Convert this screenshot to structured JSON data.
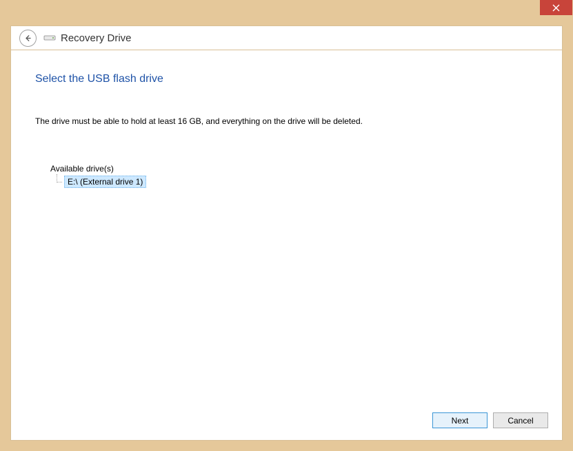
{
  "titlebar": {
    "close_label": "Close"
  },
  "header": {
    "title": "Recovery Drive"
  },
  "content": {
    "heading": "Select the USB flash drive",
    "description": "The drive must be able to hold at least 16 GB, and everything on the drive will be deleted.",
    "tree_label": "Available drive(s)",
    "drives": [
      {
        "label": "E:\\ (External drive 1)",
        "selected": true
      }
    ]
  },
  "buttons": {
    "next": "Next",
    "cancel": "Cancel"
  }
}
